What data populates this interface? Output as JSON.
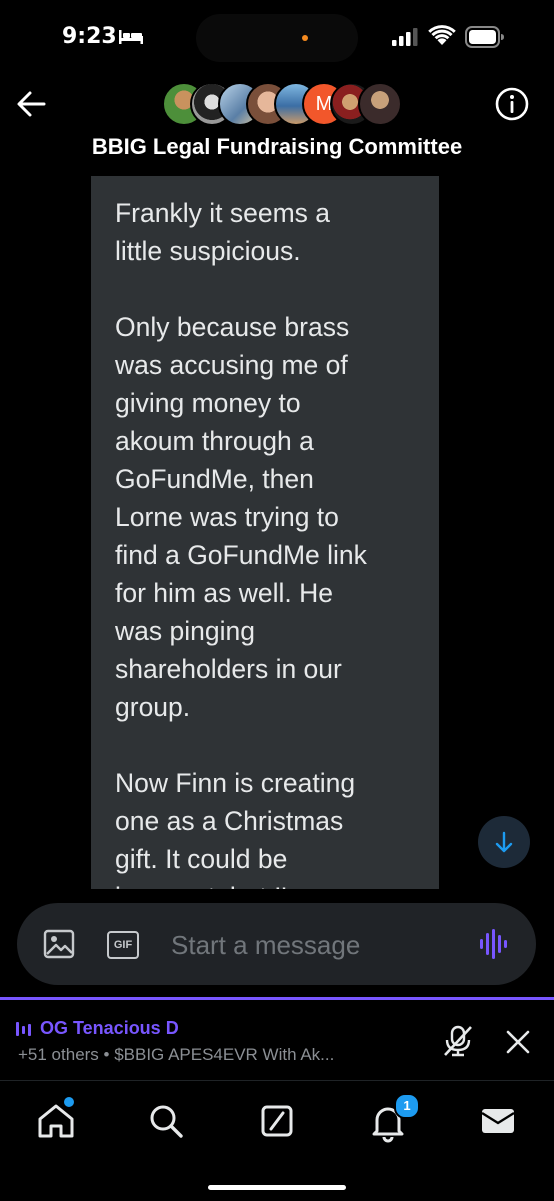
{
  "status_bar": {
    "time": "9:23"
  },
  "header": {
    "title": "BBIG Legal Fundraising Committee",
    "avatar_initial": "M"
  },
  "message": {
    "text": "Frankly it seems a\nlittle suspicious.\n\nOnly because brass\nwas accusing me of\ngiving money to\nakoum through a\nGoFundMe, then\nLorne was trying to\nfind a GoFundMe link\nfor him as well. He\nwas pinging\nshareholders in our\ngroup.\n\nNow Finn is creating\none as a Christmas\ngift. It could be\ninnocent, but I'm"
  },
  "composer": {
    "placeholder": "Start a message",
    "gif_label": "GIF"
  },
  "space": {
    "title": "OG Tenacious D",
    "subtitle": "+51 others • $BBIG APES4EVR With Ak..."
  },
  "tabs": {
    "notification_count": "1"
  },
  "colors": {
    "accent": "#1d9bf0",
    "space_purple": "#7856ff",
    "bubble": "#2f3336"
  }
}
